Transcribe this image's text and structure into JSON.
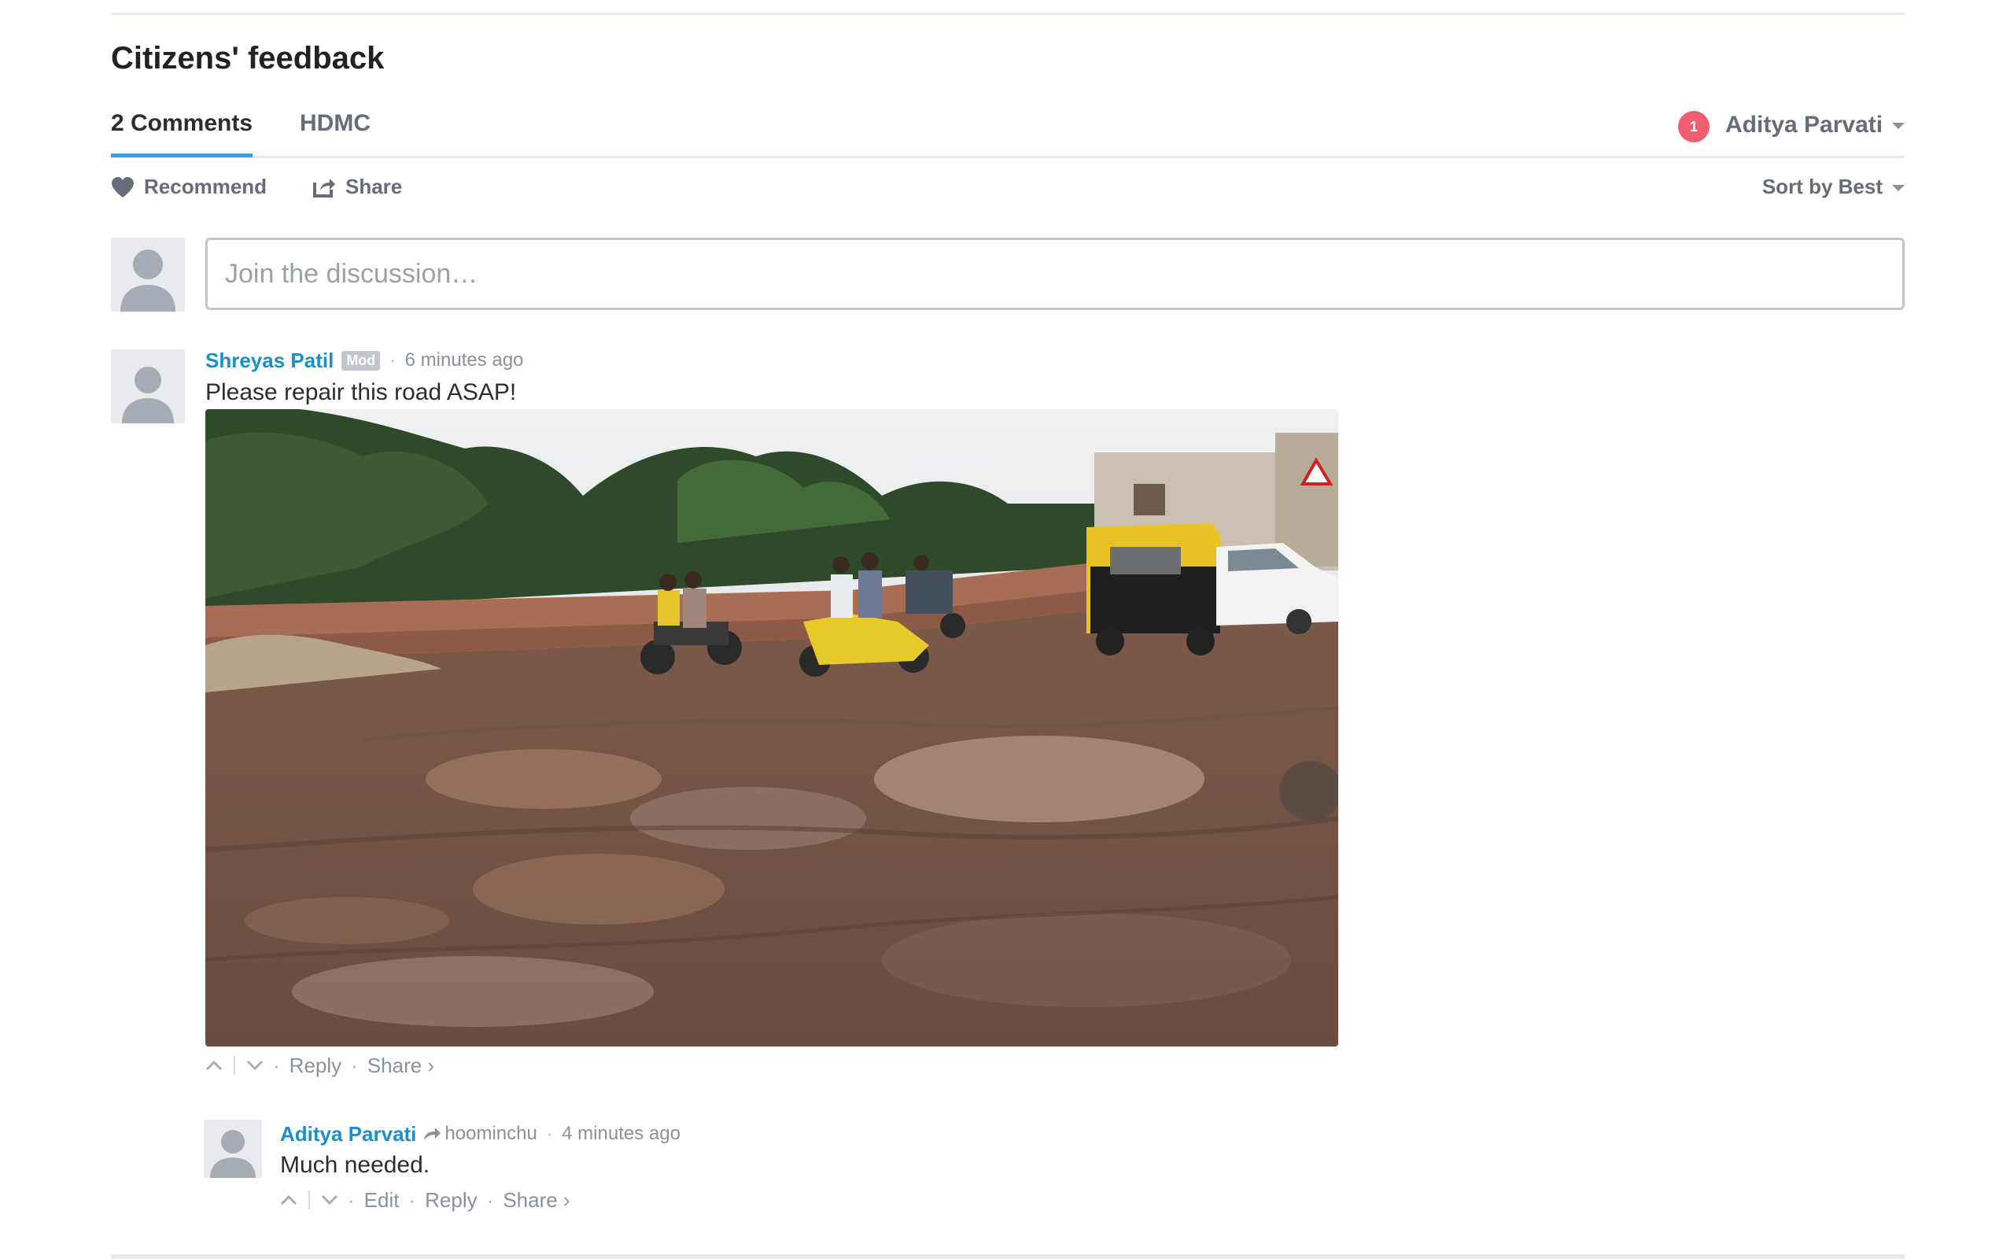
{
  "section_title": "Citizens' feedback",
  "tabs": {
    "comments_label": "2 Comments",
    "community_label": "HDMC"
  },
  "user": {
    "name": "Aditya Parvati",
    "notification_count": "1"
  },
  "actions": {
    "recommend_label": "Recommend",
    "share_label": "Share",
    "sort_label": "Sort by Best"
  },
  "compose": {
    "placeholder": "Join the discussion…"
  },
  "comments": [
    {
      "author": "Shreyas Patil",
      "badge": "Mod",
      "time": "6 minutes ago",
      "text": "Please repair this road ASAP!",
      "image": "photo of a muddy, pothole-filled road with water puddles, motorbikes and an auto-rickshaw",
      "footer": {
        "reply": "Reply",
        "share": "Share ›"
      }
    },
    {
      "author": "Aditya Parvati",
      "reply_to": "hoominchu",
      "time": "4 minutes ago",
      "text": "Much needed.",
      "footer": {
        "edit": "Edit",
        "reply": "Reply",
        "share": "Share ›"
      }
    }
  ],
  "colors": {
    "accent": "#2e9fff",
    "author_link": "#1a8fc9",
    "notification": "#f05f70",
    "muted": "#656c7a"
  },
  "icons": [
    "heart-icon",
    "share-box-icon",
    "caret-down-icon",
    "avatar-placeholder-icon",
    "upvote-icon",
    "downvote-icon",
    "reply-arrow-icon"
  ]
}
